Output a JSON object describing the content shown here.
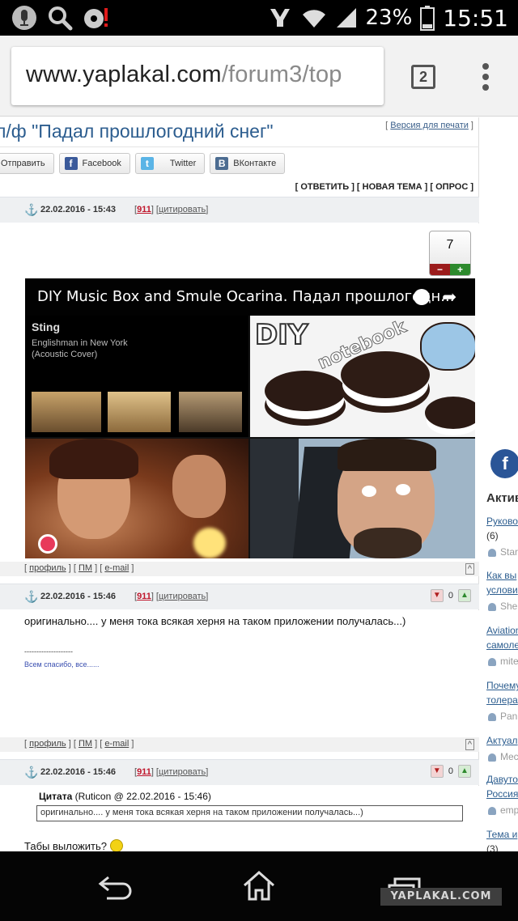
{
  "status_bar": {
    "battery": "23%",
    "time": "15:51"
  },
  "browser": {
    "url_domain": "www.yaplakal.com",
    "url_path": "/forum3/top",
    "tab_count": "2"
  },
  "topic": {
    "title": "л/ф \"Падал прошлогодний снег\"",
    "print_link": "Версия для печати"
  },
  "share": {
    "send": "Отправить",
    "facebook": "Facebook",
    "twitter": "Twitter",
    "vkontakte": "ВКонтакте"
  },
  "actions": {
    "reply": "ОТВЕТИТЬ",
    "new_topic": "НОВАЯ ТЕМА",
    "poll": "ОПРОС"
  },
  "posts": [
    {
      "date": "22.02.2016 - 15:43",
      "num": "911",
      "quote_link": "цитировать",
      "rating": "7",
      "video_title": "DIY Music Box and Smule Ocarina. Падал прошлогодн...",
      "video_sting_title": "Sting",
      "video_sting_sub1": "Englishman in New York",
      "video_sting_sub2": "(Acoustic Cover)",
      "video_diy": "DIY",
      "video_notebook": "notebook"
    },
    {
      "date": "22.02.2016 - 15:46",
      "num": "911",
      "quote_link": "цитировать",
      "rating": "0",
      "text": "оригинально.... у меня тока всякая херня на таком приложении получалась...)",
      "signature_line": "--------------------",
      "signature": "Всем спасибо, все......"
    },
    {
      "date": "22.02.2016 - 15:46",
      "num": "911",
      "quote_link": "цитировать",
      "rating": "0",
      "quote_label": "Цитата",
      "quote_author": "(Ruticon @ 22.02.2016 - 15:46)",
      "quote_text": "оригинально.... у меня тока всякая херня на таком приложении получалась...)",
      "text": "Табы выложить?"
    }
  ],
  "post_footer": {
    "profile": "профиль",
    "pm": "ПМ",
    "email": "e-mail",
    "up": "^"
  },
  "sidebar": {
    "title": "Актив",
    "items": [
      {
        "link": "Руково",
        "extra": "(6)",
        "user": "Star"
      },
      {
        "link": "Как вы",
        "link2": "услови",
        "user": "She"
      },
      {
        "link": "Aviation",
        "link2": "самоле",
        "user": "mite"
      },
      {
        "link": "Почему",
        "link2": "толера",
        "user": "Pan"
      },
      {
        "link": "Актуал",
        "user": "Mec"
      },
      {
        "link": "Давуто",
        "link2": "Россия",
        "user": "emp"
      },
      {
        "link": "Тема и",
        "extra": "(3)"
      }
    ]
  },
  "watermark": "YAPLAKAL.COM",
  "colors": {
    "link": "#2c5d8f",
    "accent_red": "#c0162c",
    "vote_minus": "#9b1b1b",
    "vote_plus": "#2d8a2d",
    "facebook": "#2a5597"
  }
}
